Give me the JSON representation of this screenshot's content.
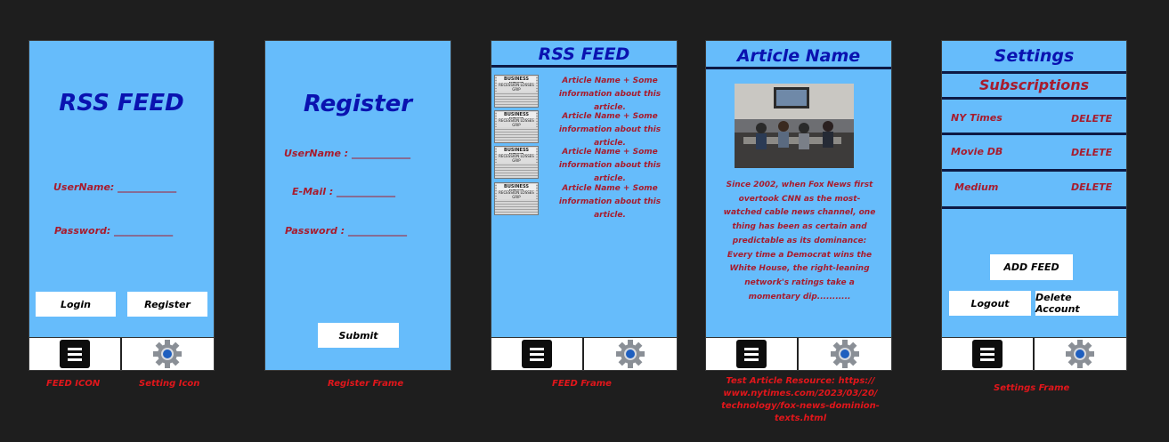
{
  "login": {
    "title": "RSS FEED",
    "username_label": "UserName: ____________",
    "password_label": "Password: ____________",
    "login_button": "Login",
    "register_button": "Register"
  },
  "register": {
    "title": "Register",
    "username_label": "UserName : ____________",
    "email_label": "E-Mail : ____________",
    "password_label": "Password : ____________",
    "submit_button": "Submit"
  },
  "feed": {
    "title": "RSS FEED",
    "items": [
      {
        "text": "Article Name + Some information about this article.",
        "thumb_head": "BUSINESS NEWS",
        "thumb_sub": "RECESSION LOSSES GRIP"
      },
      {
        "text": "Article Name + Some information about this article.",
        "thumb_head": "BUSINESS NEWS",
        "thumb_sub": "RECESSION LOSSES GRIP"
      },
      {
        "text": "Article Name + Some information about this article.",
        "thumb_head": "BUSINESS NEWS",
        "thumb_sub": "RECESSION LOSSES GRIP"
      },
      {
        "text": "Article Name + Some information about this article.",
        "thumb_head": "BUSINESS NEWS",
        "thumb_sub": "RECESSION LOSSES GRIP"
      }
    ]
  },
  "article": {
    "title": "Article Name",
    "body": "Since 2002, when Fox News first overtook CNN as the most-watched cable news channel, one thing has been as certain and predictable as its dominance: Every time a Democrat wins the White House, the right-leaning network's ratings take a momentary dip..........."
  },
  "settings": {
    "title": "Settings",
    "subscriptions_label": "Subscriptions",
    "subscriptions": [
      {
        "name": "NY Times",
        "action": "DELETE"
      },
      {
        "name": "Movie DB",
        "action": "DELETE"
      },
      {
        "name": "Medium",
        "action": "DELETE"
      }
    ],
    "add_feed_button": "ADD FEED",
    "logout_button": "Logout",
    "delete_account_button": "Delete Account"
  },
  "captions": {
    "feed_icon": "FEED ICON",
    "setting_icon": "Setting Icon",
    "register_frame": "Register Frame",
    "feed_frame": "FEED Frame",
    "article_resource": "Test Article Resource: https:// www.nytimes.com/2023/03/20/ technology/fox-news-dominion- texts.html",
    "settings_frame": "Settings Frame"
  },
  "icons": {
    "menu": "menu-icon",
    "settings": "gear-icon"
  },
  "colors": {
    "frame_bg": "#66bcfb",
    "title": "#0a12b0",
    "label": "#a71c2e",
    "caption": "#e1161b",
    "canvas": "#1e1e1e"
  }
}
